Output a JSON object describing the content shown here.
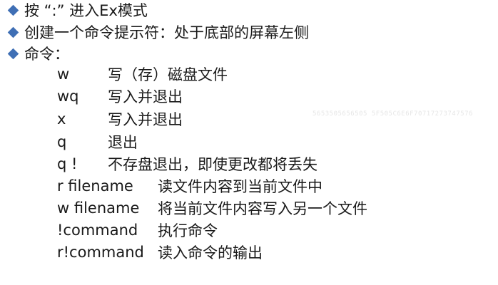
{
  "bullets": [
    {
      "text": "按 “:” 进入Ex模式"
    },
    {
      "text": "创建一个命令提示符：处于底部的屏幕左侧"
    },
    {
      "text": "命令："
    }
  ],
  "commands": [
    {
      "name": "w",
      "desc": "写（存）磁盘文件"
    },
    {
      "name": "wq",
      "desc": "写入并退出"
    },
    {
      "name": "x",
      "desc": "写入并退出"
    },
    {
      "name": "q",
      "desc": "退出"
    },
    {
      "name": "q !",
      "desc": "不存盘退出，即使更改都将丢失"
    },
    {
      "name": "r filename",
      "desc": "读文件内容到当前文件中"
    },
    {
      "name": "w filename",
      "desc": "将当前文件内容写入另一个文件"
    },
    {
      "name": "!command",
      "desc": "执行命令"
    },
    {
      "name": "r!command",
      "desc": "读入命令的输出"
    }
  ],
  "watermark": "5653505656505 5F505C6E6F70717273747576"
}
